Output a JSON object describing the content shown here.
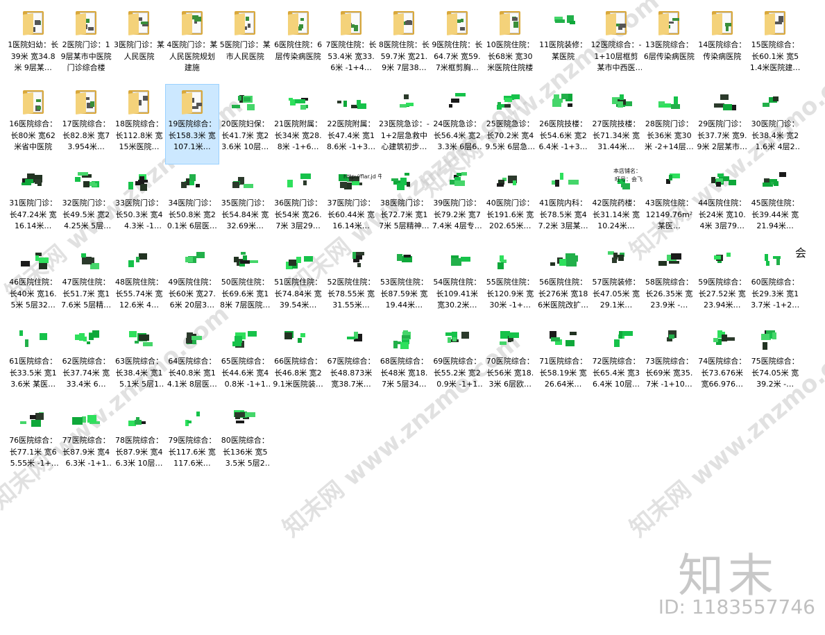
{
  "items": [
    {
      "label": "1医院妇幼：长39米 宽34.8米 9层某…",
      "icon": "folder"
    },
    {
      "label": "2医院门诊：19层某市中医院门诊综合楼",
      "icon": "folder"
    },
    {
      "label": "3医院门诊：某人民医院",
      "icon": "folder"
    },
    {
      "label": "4医院门诊：某人民医院规划建施",
      "icon": "folder"
    },
    {
      "label": "5医院门诊：某市人民医院",
      "icon": "folder"
    },
    {
      "label": "6医院住院：6层传染病医院",
      "icon": "folder"
    },
    {
      "label": "7医院住院：长53.4米 宽33.6米 -1+4…",
      "icon": "folder"
    },
    {
      "label": "8医院住院：长59.7米 宽21.9米 7层38…",
      "icon": "folder"
    },
    {
      "label": "9医院住院：长64.7米 宽59.7米框剪胸…",
      "icon": "folder"
    },
    {
      "label": "10医院住院：长68米 宽30米医院住院楼",
      "icon": "folder"
    },
    {
      "label": "11医院装修：某医院",
      "icon": "drawing"
    },
    {
      "label": "12医院综合：-1+10层框剪某市中西医结…",
      "icon": "folder"
    },
    {
      "label": "13医院综合：6层传染病医院",
      "icon": "folder"
    },
    {
      "label": "14医院综合：传染病医院",
      "icon": "folder"
    },
    {
      "label": "15医院综合：长60.1米 宽51.4米医院建…",
      "icon": "folder"
    },
    {
      "label": "16医院综合：长80米 宽62米省中医院",
      "icon": "folder"
    },
    {
      "label": "17医院综合：长82.8米 宽73.954米…",
      "icon": "folder"
    },
    {
      "label": "18医院综合：长112.8米 宽15米医院…",
      "icon": "folder"
    },
    {
      "label": "19医院综合：长158.3米 宽107.1米…",
      "icon": "folder",
      "selected": true
    },
    {
      "label": "20医院妇保：长41.7米 宽23.6米 10层…",
      "icon": "drawing"
    },
    {
      "label": "21医院附属：长34米 宽28.8米 -1+6…",
      "icon": "drawing"
    },
    {
      "label": "22医院附属：长47.4米 宽18.6米 -1+3…",
      "icon": "drawing"
    },
    {
      "label": "23医院急诊：-1+2层急救中心建筑初步…",
      "icon": "drawing"
    },
    {
      "label": "24医院急诊：长56.4米 宽23.3米 6层62…",
      "icon": "drawing"
    },
    {
      "label": "25医院急诊：长70.2米 宽49.5米 6层急…",
      "icon": "drawing"
    },
    {
      "label": "26医院技楼：长54.6米 宽26.4米 -1+3…",
      "icon": "drawing"
    },
    {
      "label": "27医院技楼：长71.34米 宽31.44米…",
      "icon": "drawing"
    },
    {
      "label": "28医院门诊：长36米 宽30米 -2+14层…",
      "icon": "drawing"
    },
    {
      "label": "29医院门诊：长37.7米 宽9.9米 2层某市…",
      "icon": "drawing"
    },
    {
      "label": "30医院门诊：长38.4米 宽21.6米 4层26…",
      "icon": "drawing"
    },
    {
      "label": "31医院门诊：长47.24米 宽16.14米…",
      "icon": "drawing"
    },
    {
      "label": "32医院门诊：长49.5米 宽24.25米 5层47…",
      "icon": "drawing"
    },
    {
      "label": "33医院门诊：长50.3米 宽44.3米 -1+局…",
      "icon": "drawing"
    },
    {
      "label": "34医院门诊：长50.8米 宽20.1米 6层医…",
      "icon": "drawing"
    },
    {
      "label": "35医院门诊：长54.84米 宽32.69米…",
      "icon": "drawing"
    },
    {
      "label": "36医院门诊：长54米 宽26.7米 3层29…",
      "icon": "drawing"
    },
    {
      "label": "37医院门诊：长60.44米 宽16.14米…",
      "icon": "drawing"
    },
    {
      "label": "38医院门诊：长72.7米 宽17米 5层精神…",
      "icon": "drawing"
    },
    {
      "label": "39医院门诊：长79.2米 宽77.4米 4层专…",
      "icon": "drawing"
    },
    {
      "label": "40医院门诊：长191.6米 宽202.65米…",
      "icon": "drawing"
    },
    {
      "label": "41医院内科：长78.5米 宽47.2米 3层某人民…",
      "icon": "drawing"
    },
    {
      "label": "42医院药楼：长31.14米 宽10.24米…",
      "icon": "drawing"
    },
    {
      "label": "43医院住院：12149.76m² 某医…",
      "icon": "drawing"
    },
    {
      "label": "44医院住院：长24米 宽10.4米 3层79…",
      "icon": "drawing"
    },
    {
      "label": "45医院住院：长39.44米 宽21.94米…",
      "icon": "drawing"
    },
    {
      "label": "46医院住院：长40米 宽16.5米 5层32…",
      "icon": "drawing"
    },
    {
      "label": "47医院住院：长51.7米 宽17.6米 5层精…",
      "icon": "drawing"
    },
    {
      "label": "48医院住院：长55.74米 宽12.6米 4…",
      "icon": "drawing"
    },
    {
      "label": "49医院住院：长60米 宽27.6米 20层3…",
      "icon": "drawing"
    },
    {
      "label": "50医院住院：长69.6米 宽18米 7层医院…",
      "icon": "drawing"
    },
    {
      "label": "51医院住院：长74.84米 宽39.54米…",
      "icon": "drawing"
    },
    {
      "label": "52医院住院：长78.55米 宽31.55米…",
      "icon": "drawing"
    },
    {
      "label": "53医院住院：长87.59米 宽19.44米…",
      "icon": "drawing"
    },
    {
      "label": "54医院住院：长109.41米 宽30.2米…",
      "icon": "drawing"
    },
    {
      "label": "55医院住院：长120.9米 宽30米 -1+…",
      "icon": "drawing"
    },
    {
      "label": "56医院住院：长276米 宽186米医院改扩…",
      "icon": "drawing"
    },
    {
      "label": "57医院装修：长47.05米 宽29.1米…",
      "icon": "drawing"
    },
    {
      "label": "58医院综合：长26.35米 宽23.9米 -…",
      "icon": "drawing"
    },
    {
      "label": "59医院综合：长27.52米 宽23.94米…",
      "icon": "drawing"
    },
    {
      "label": "60医院综合：长29.3米 宽13.7米 -1+2…",
      "icon": "drawing"
    },
    {
      "label": "61医院综合：长33.5米 宽13.6米 某医…",
      "icon": "drawing"
    },
    {
      "label": "62医院综合：长37.74米 宽33.4米 6…",
      "icon": "drawing"
    },
    {
      "label": "63医院综合：长38.4米 宽15.1米 5层17…",
      "icon": "drawing"
    },
    {
      "label": "64医院综合：长40.8米 宽14.1米 8层医…",
      "icon": "drawing"
    },
    {
      "label": "65医院综合：长44.6米 宽40.8米 -1+16…",
      "icon": "drawing"
    },
    {
      "label": "66医院综合：长46.8米 宽29.1米医院装…",
      "icon": "drawing"
    },
    {
      "label": "67医院综合：长48.873米 宽38.7米…",
      "icon": "drawing"
    },
    {
      "label": "68医院综合：长48米 宽18.7米 5层34…",
      "icon": "drawing"
    },
    {
      "label": "69医院综合：长55.2米 宽20.9米 -1+11…",
      "icon": "drawing"
    },
    {
      "label": "70医院综合：长56米 宽18.3米 6层欧…",
      "icon": "drawing"
    },
    {
      "label": "71医院综合：长58.19米 宽26.64米…",
      "icon": "drawing"
    },
    {
      "label": "72医院综合：长65.4米 宽36.4米 10层…",
      "icon": "drawing"
    },
    {
      "label": "73医院综合：长69米 宽35.7米 -1+10…",
      "icon": "drawing"
    },
    {
      "label": "74医院综合：长73.676米 宽66.976…",
      "icon": "drawing"
    },
    {
      "label": "75医院综合：长74.05米 宽39.2米 -…",
      "icon": "drawing"
    },
    {
      "label": "76医院综合：长77.1米 宽65.55米 -1+18…",
      "icon": "drawing"
    },
    {
      "label": "77医院综合：长87.9米 宽46.3米 -1+17…",
      "icon": "drawing"
    },
    {
      "label": "78医院综合：长87.9米 宽46.3米 10层…",
      "icon": "drawing"
    },
    {
      "label": "79医院综合：长117.6米 宽117.6米…",
      "icon": "drawing"
    },
    {
      "label": "80医院综合：长136米 宽53.5米 5层26…",
      "icon": "drawing"
    }
  ],
  "thumb_notes": {
    "n37": "http://flar.jd 牛:小飞你小幽",
    "n42a": "本店铺名：",
    "n42b": "旺号：会飞",
    "n60": "会"
  },
  "watermark": {
    "text": "知末网 www.znzmo.com",
    "brand": "知末",
    "id_line": "ID: 1183557746"
  },
  "colors": {
    "folder_back": "#d9a83a",
    "folder_front": "#f4d27a",
    "selection": "#cce8ff",
    "drawing_green": "#16c24a"
  }
}
